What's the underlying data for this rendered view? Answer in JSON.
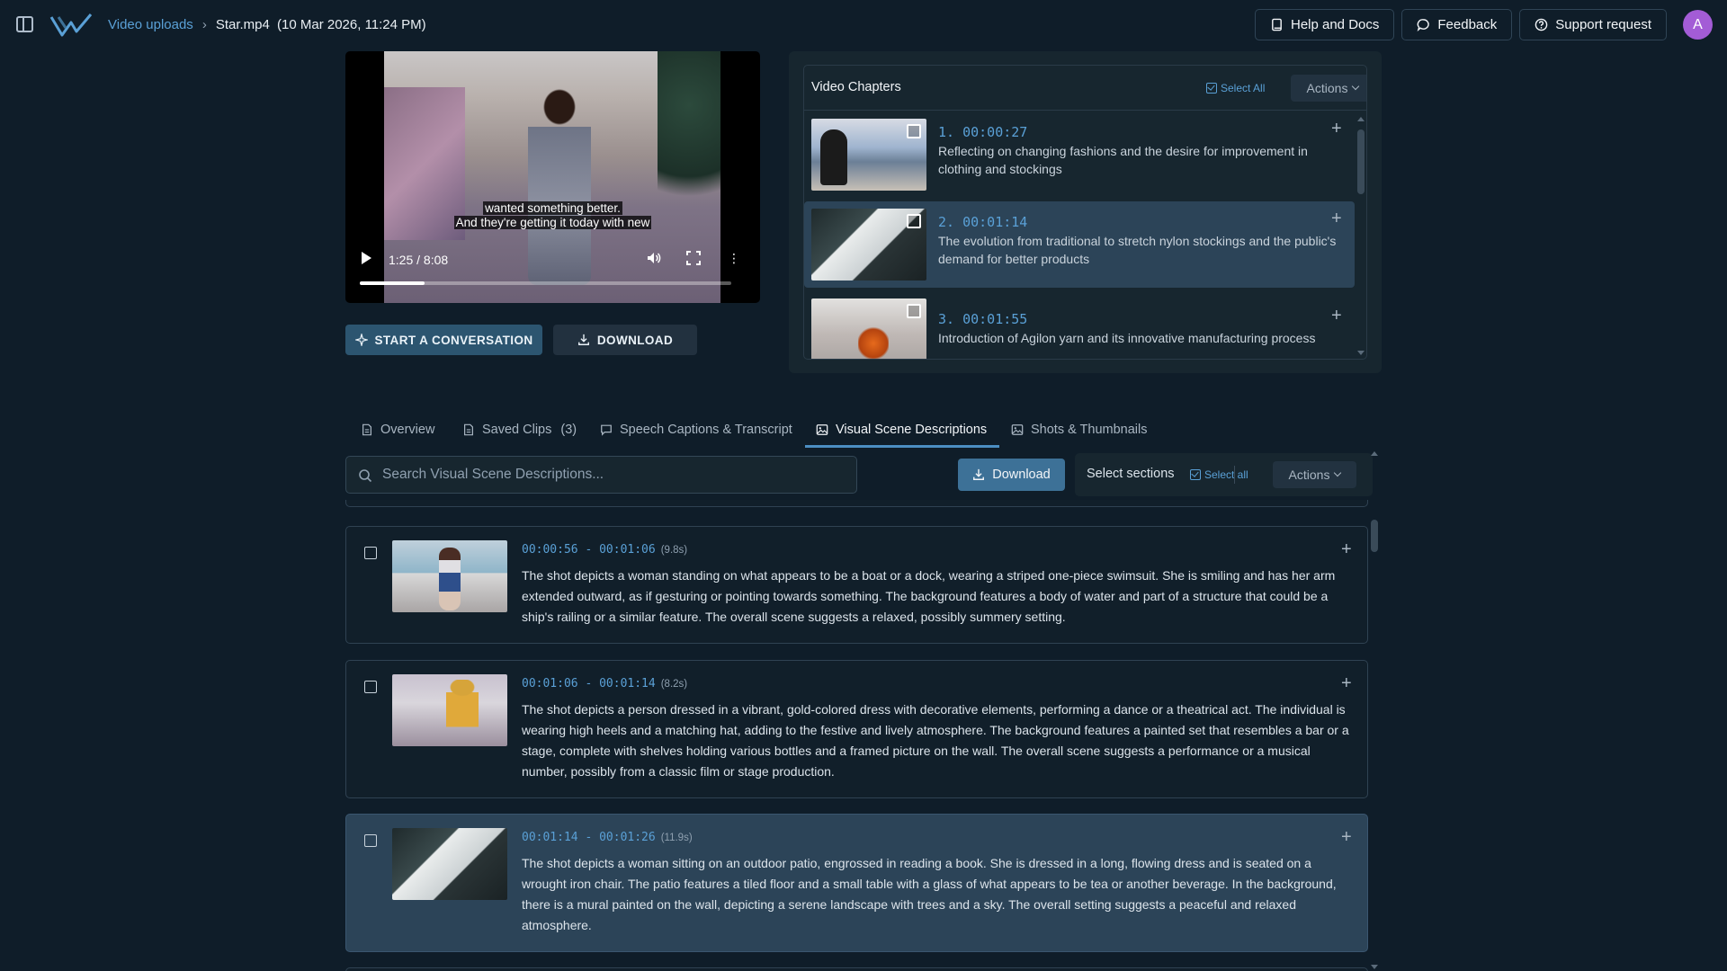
{
  "breadcrumb": {
    "parent": "Video uploads",
    "current": "Star.mp4",
    "date": "(10 Mar 2026, 11:24 PM)"
  },
  "header": {
    "help": "Help and Docs",
    "feedback": "Feedback",
    "support": "Support request",
    "avatar": "A"
  },
  "player": {
    "caption_line1": "wanted something better.",
    "caption_line2": "And they're getting it today with new",
    "time": "1:25 / 8:08",
    "progress_fraction": 0.175
  },
  "actions": {
    "conversation": "START A CONVERSATION",
    "download": "DOWNLOAD"
  },
  "chapters": {
    "title": "Video Chapters",
    "select_all": "Select All",
    "actions": "Actions",
    "items": [
      {
        "time": "1. 00:00:27",
        "desc": "Reflecting on changing fashions and the desire for improvement in clothing and stockings"
      },
      {
        "time": "2. 00:01:14",
        "desc": "The evolution from traditional to stretch nylon stockings and the public's demand for better products"
      },
      {
        "time": "3. 00:01:55",
        "desc": "Introduction of Agilon yarn and its innovative manufacturing process"
      }
    ]
  },
  "tabs": {
    "overview": "Overview",
    "saved_clips": "Saved Clips",
    "saved_clips_count": "(3)",
    "speech": "Speech Captions & Transcript",
    "visual": "Visual Scene Descriptions",
    "shots": "Shots & Thumbnails"
  },
  "toolbar": {
    "search_placeholder": "Search Visual Scene Descriptions...",
    "download": "Download",
    "select_sections": "Select sections",
    "select_all": "Select all",
    "actions": "Actions"
  },
  "scenes": [
    {
      "range": "00:00:56 - 00:01:06",
      "duration": "(9.8s)",
      "text": "The shot depicts a woman standing on what appears to be a boat or a dock, wearing a striped one-piece swimsuit. She is smiling and has her arm extended outward, as if gesturing or pointing towards something. The background features a body of water and part of a structure that could be a ship's railing or a similar feature. The overall scene suggests a relaxed, possibly summery setting."
    },
    {
      "range": "00:01:06 - 00:01:14",
      "duration": "(8.2s)",
      "text": "The shot depicts a person dressed in a vibrant, gold-colored dress with decorative elements, performing a dance or a theatrical act. The individual is wearing high heels and a matching hat, adding to the festive and lively atmosphere. The background features a painted set that resembles a bar or a stage, complete with shelves holding various bottles and a framed picture on the wall. The overall scene suggests a performance or a musical number, possibly from a classic film or stage production."
    },
    {
      "range": "00:01:14 - 00:01:26",
      "duration": "(11.9s)",
      "text": "The shot depicts a woman sitting on an outdoor patio, engrossed in reading a book. She is dressed in a long, flowing dress and is seated on a wrought iron chair. The patio features a tiled floor and a small table with a glass of what appears to be tea or another beverage. In the background, there is a mural painted on the wall, depicting a serene landscape with trees and a sky. The overall setting suggests a peaceful and relaxed atmosphere."
    }
  ],
  "colors": {
    "background": "#0f1d29",
    "accent": "#5aa0d6",
    "active_row": "#2c4458",
    "primary_button": "#3d7197",
    "avatar": "#a35cd6"
  }
}
